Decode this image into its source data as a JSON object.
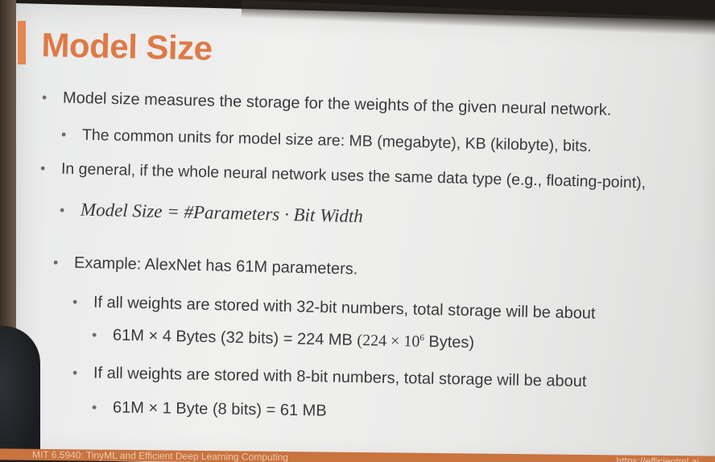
{
  "slide": {
    "title": "Model Size",
    "bullets": [
      {
        "level": 1,
        "text": "Model size measures the storage for the weights of the given neural network."
      },
      {
        "level": 2,
        "text": "The common units for model size are: MB (megabyte), KB (kilobyte), bits."
      },
      {
        "level": 1,
        "text": "In general, if the whole neural network uses the same data type (e.g., floating-point),"
      },
      {
        "level": 2,
        "formula": "Model  Size = #Parameters · Bit Width"
      },
      {
        "level": 1,
        "text": "Example: AlexNet has 61M parameters."
      },
      {
        "level": 2,
        "text": "If all weights are stored with 32-bit numbers, total storage will be about"
      },
      {
        "level": 3,
        "text_main": "61M × 4 Bytes (32 bits) = 224 MB",
        "text_paren_open": "(224 × 10",
        "text_sup": "6",
        "text_paren_close": " Bytes)"
      },
      {
        "level": 2,
        "text": "If all weights are stored with 8-bit numbers, total storage will be about"
      },
      {
        "level": 3,
        "text": "61M × 1 Byte (8 bits) = 61 MB"
      }
    ],
    "bullet_glyph": "•",
    "footer_left": "MIT 6.5940: TinyML and Efficient Deep Learning Computing",
    "footer_right": "https://efficientml.ai"
  },
  "colors": {
    "title": "#de7a46",
    "accent": "#e3874f",
    "footer_bar": "#c9733f",
    "text": "#3a3a3a"
  }
}
